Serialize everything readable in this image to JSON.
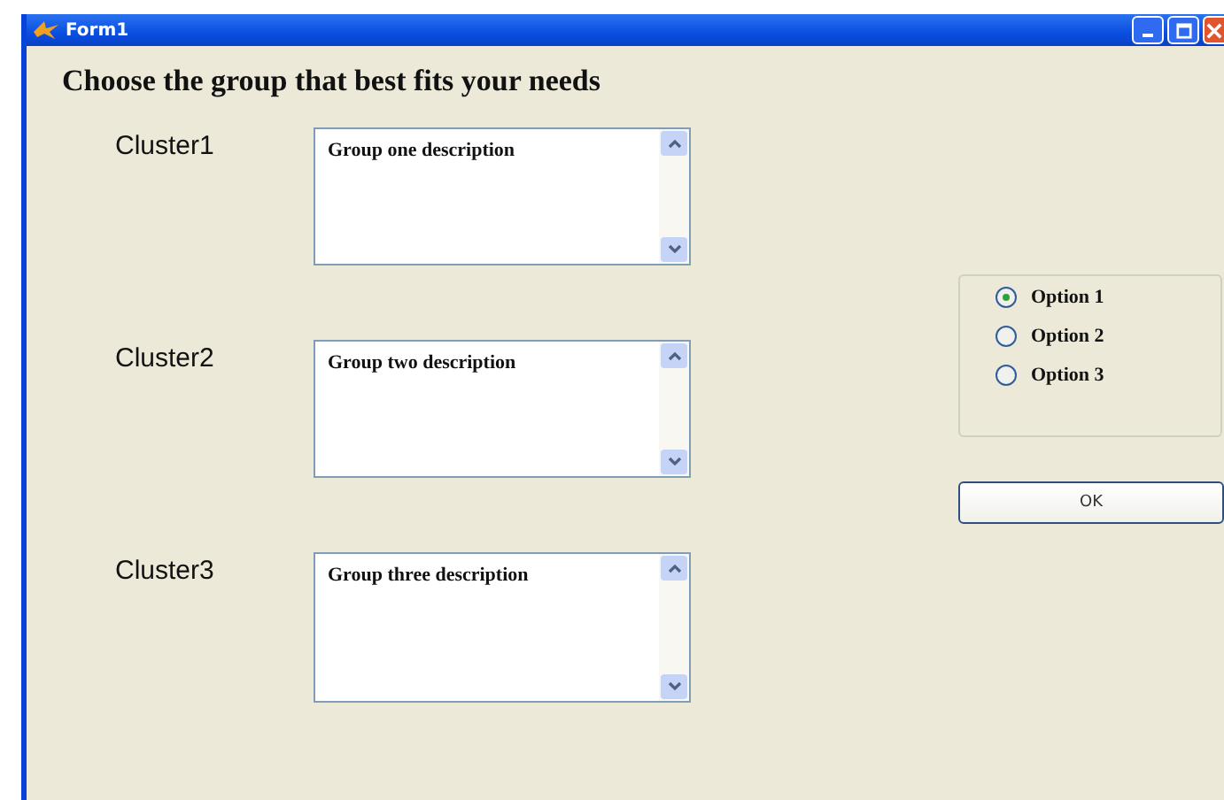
{
  "window": {
    "title": "Form1"
  },
  "heading": "Choose the group that best fits your needs",
  "clusters": [
    {
      "label": "Cluster1",
      "description": "Group one description"
    },
    {
      "label": "Cluster2",
      "description": "Group two description"
    },
    {
      "label": "Cluster3",
      "description": "Group three description"
    }
  ],
  "options": [
    {
      "label": "Option 1",
      "selected": true
    },
    {
      "label": "Option 2",
      "selected": false
    },
    {
      "label": "Option 3",
      "selected": false
    }
  ],
  "buttons": [
    "OK"
  ]
}
